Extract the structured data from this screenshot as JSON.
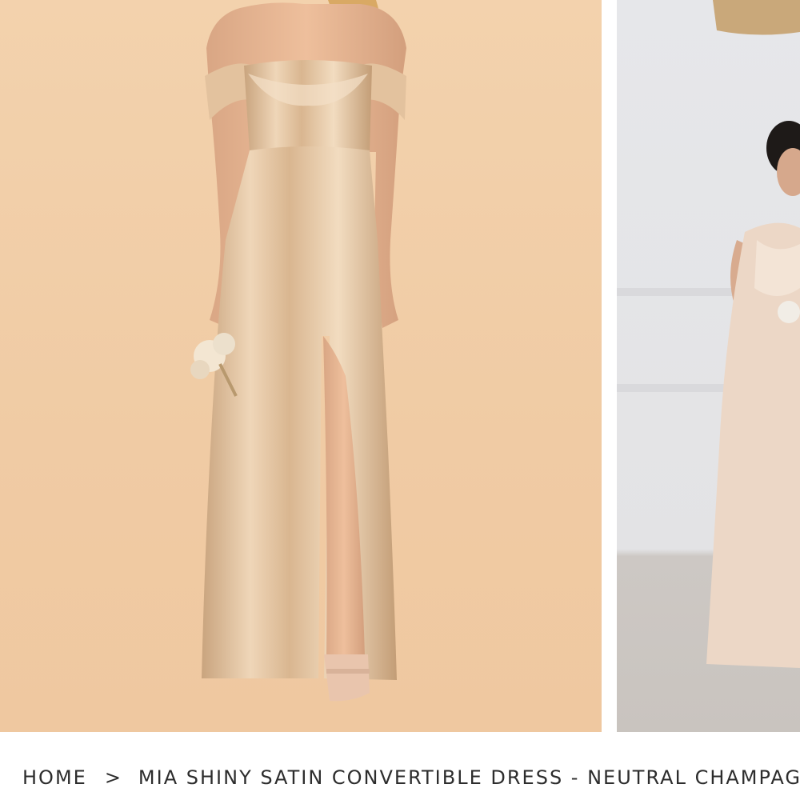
{
  "breadcrumb": {
    "home_label": "HOME",
    "separator": ">",
    "current_label": "MIA SHINY SATIN CONVERTIBLE DRESS - NEUTRAL CHAMPAGNE"
  },
  "gallery": {
    "main_photo": {
      "background": "#f1cda7",
      "dress_color": "#e1c09c"
    },
    "side_photo": {
      "background": "#e5e6e9",
      "dress_color": "#ecd7c6"
    }
  }
}
